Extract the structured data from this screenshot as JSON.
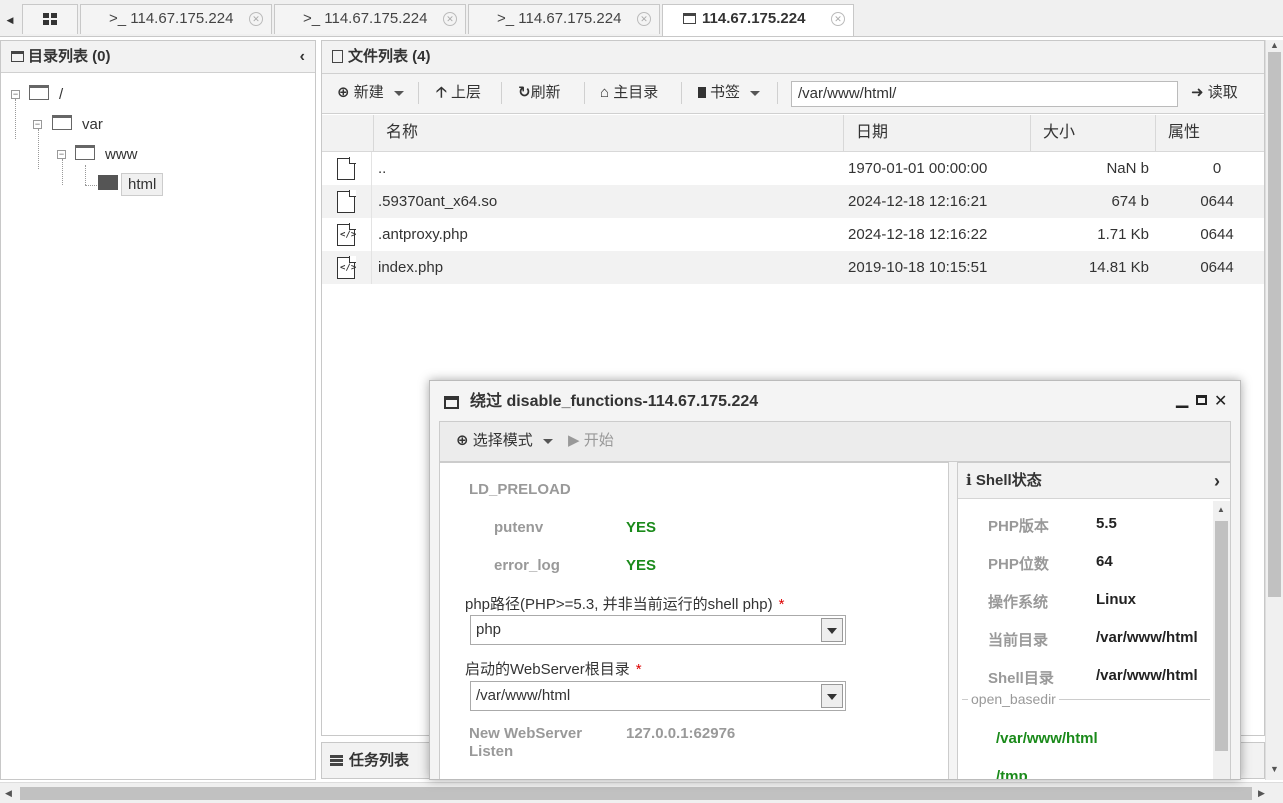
{
  "tabs": [
    {
      "label": ">_ 114.67.175.224"
    },
    {
      "label": ">_ 114.67.175.224"
    },
    {
      "label": ">_ 114.67.175.224"
    },
    {
      "label": "114.67.175.224"
    }
  ],
  "dir_panel": {
    "title": "目录列表 (0)",
    "tree": [
      "/",
      "var",
      "www",
      "html"
    ]
  },
  "file_panel": {
    "title": "文件列表 (4)",
    "toolbar": {
      "new": "新建",
      "up": "上层",
      "refresh": "刷新",
      "home": "主目录",
      "bookmark": "书签",
      "path": "/var/www/html/",
      "read": "读取"
    },
    "columns": [
      "名称",
      "日期",
      "大小",
      "属性"
    ],
    "rows": [
      {
        "name": "..",
        "date": "1970-01-01 00:00:00",
        "size": "NaN b",
        "attr": "0",
        "icon": "file-icon"
      },
      {
        "name": ".59370ant_x64.so",
        "date": "2024-12-18 12:16:21",
        "size": "674 b",
        "attr": "0644",
        "icon": "file-icon"
      },
      {
        "name": ".antproxy.php",
        "date": "2024-12-18 12:16:22",
        "size": "1.71 Kb",
        "attr": "0644",
        "icon": "code-file-icon"
      },
      {
        "name": "index.php",
        "date": "2019-10-18 10:15:51",
        "size": "14.81 Kb",
        "attr": "0644",
        "icon": "code-file-icon"
      }
    ]
  },
  "task_bar": {
    "label": "任务列表"
  },
  "dialog": {
    "title": "绕过 disable_functions-114.67.175.224",
    "toolbar": {
      "mode": "选择模式",
      "start": "开始"
    },
    "method": "LD_PRELOAD",
    "checks": [
      {
        "label": "putenv",
        "value": "YES"
      },
      {
        "label": "error_log",
        "value": "YES"
      }
    ],
    "php_path_label": "php路径(PHP>=5.3, 并非当前运行的shell php)",
    "php_path_value": "php",
    "webroot_label": "启动的WebServer根目录",
    "webroot_value": "/var/www/html",
    "listen_label": "New WebServer Listen",
    "listen_value": "127.0.0.1:62976",
    "required_mark": "*",
    "shell_status": {
      "title": "Shell状态",
      "items": [
        {
          "label": "PHP版本",
          "value": "5.5"
        },
        {
          "label": "PHP位数",
          "value": "64"
        },
        {
          "label": "操作系统",
          "value": "Linux"
        },
        {
          "label": "当前目录",
          "value": "/var/www/html"
        },
        {
          "label": "Shell目录",
          "value": "/var/www/html"
        }
      ],
      "open_basedir_label": "open_basedir",
      "open_basedir": [
        "/var/www/html",
        "/tmp"
      ]
    }
  }
}
